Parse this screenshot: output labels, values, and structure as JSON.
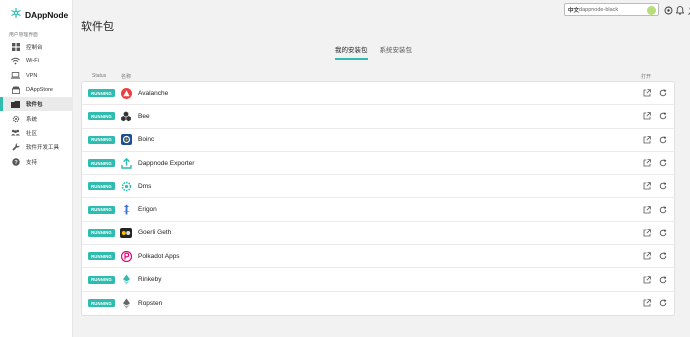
{
  "app": {
    "brand": "DAppNode"
  },
  "sidebar": {
    "section_label": "用户管理界面",
    "items": [
      {
        "label": "控制台",
        "icon": "dashboard-icon"
      },
      {
        "label": "Wi-Fi",
        "icon": "wifi-icon"
      },
      {
        "label": "VPN",
        "icon": "laptop-icon"
      },
      {
        "label": "DAppStore",
        "icon": "store-icon"
      },
      {
        "label": "软件包",
        "icon": "folder-icon",
        "active": true
      },
      {
        "label": "系统",
        "icon": "gear-icon"
      },
      {
        "label": "社区",
        "icon": "people-icon"
      },
      {
        "label": "软件开发工具",
        "icon": "wrench-icon"
      },
      {
        "label": "支持",
        "icon": "help-icon"
      }
    ]
  },
  "topbar": {
    "dropdown_prefix": "中文",
    "dropdown_value": "dappnode-black",
    "icons": [
      "dappnode-status-icon",
      "bell-icon",
      "user-icon"
    ]
  },
  "page": {
    "title": "软件包"
  },
  "tabs": [
    {
      "label": "我的安装包",
      "active": true
    },
    {
      "label": "系统安装包",
      "active": false
    }
  ],
  "table": {
    "headers": {
      "status": "Status",
      "name": "名称",
      "open": "打开"
    },
    "rows": [
      {
        "status": "RUNNING",
        "name": "Avalanche",
        "icon": "avalanche-icon",
        "color": "#e84142"
      },
      {
        "status": "RUNNING",
        "name": "Bee",
        "icon": "bee-icon",
        "color": "#333333"
      },
      {
        "status": "RUNNING",
        "name": "Boinc",
        "icon": "boinc-icon",
        "color": "#1d4f91"
      },
      {
        "status": "RUNNING",
        "name": "Dappnode Exporter",
        "icon": "export-arrow-icon",
        "color": "#2fbcb0"
      },
      {
        "status": "RUNNING",
        "name": "Dms",
        "icon": "dms-icon",
        "color": "#2fbcb0"
      },
      {
        "status": "RUNNING",
        "name": "Erigon",
        "icon": "erigon-icon",
        "color": "#3b6fd8"
      },
      {
        "status": "RUNNING",
        "name": "Goerli Geth",
        "icon": "goerli-geth-icon",
        "color": "#222222"
      },
      {
        "status": "RUNNING",
        "name": "Polkadot Apps",
        "icon": "polkadot-icon",
        "color": "#e6007a"
      },
      {
        "status": "RUNNING",
        "name": "Rinkeby",
        "icon": "rinkeby-icon",
        "color": "#2fbcb0"
      },
      {
        "status": "RUNNING",
        "name": "Ropsten",
        "icon": "ropsten-icon",
        "color": "#666666"
      }
    ]
  },
  "colors": {
    "accent": "#2fbcb0",
    "background": "#f2f2f2"
  }
}
